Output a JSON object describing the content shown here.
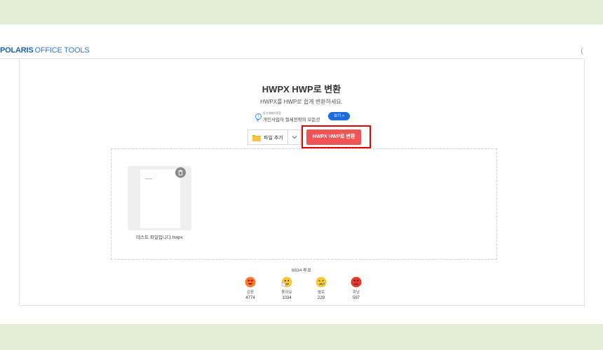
{
  "app": {
    "logo_strong": "POLARIS",
    "logo_light": "OFFICE TOOLS"
  },
  "header": {
    "title": "HWPX HWP로 변환",
    "subtitle": "HWPX를 HWP로 쉽게 변환하세요."
  },
  "ad": {
    "small_text": "동기생배안종합",
    "main_text": "개인사업자 절세전략의 모든것",
    "button_label": "보기 >"
  },
  "actions": {
    "add_file_label": "파일 추가",
    "convert_label": "HWPX HWP로 변환"
  },
  "files": [
    {
      "name": "테스트 파일입니다.hwpx"
    }
  ],
  "feedback": {
    "total_label": "6634 투표",
    "emotions": [
      {
        "name": "감동",
        "count": "4774",
        "color": "#ff5a2c"
      },
      {
        "name": "좋아요",
        "count": "1034",
        "color": "#f5c43a"
      },
      {
        "name": "별로",
        "count": "229",
        "color": "#f5c43a"
      },
      {
        "name": "화남",
        "count": "597",
        "color": "#e53b2f"
      }
    ]
  },
  "colors": {
    "accent": "#f05555",
    "brand": "#1b62b7",
    "highlight": "#e00000",
    "background": "#e2efd6"
  }
}
